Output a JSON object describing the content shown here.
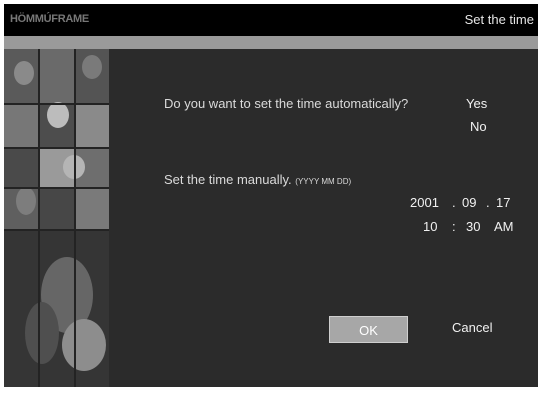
{
  "header": {
    "logo_text": "HÖMMÚFRAME",
    "title": "Set the time"
  },
  "auto_time": {
    "question": "Do you want to set the time automatically?",
    "yes_label": "Yes",
    "no_label": "No"
  },
  "manual_time": {
    "label": "Set the time manually.",
    "format_hint": "(YYYY MM DD)",
    "year": "2001",
    "month": "09",
    "day": "17",
    "hour": "10",
    "minute": "30",
    "ampm": "AM"
  },
  "buttons": {
    "ok_label": "OK",
    "cancel_label": "Cancel"
  },
  "colors": {
    "title_bar": "#000000",
    "band": "#9a9a9a",
    "panel": "#2b2b2b",
    "ok_button": "#a7a7a7"
  },
  "icons": {
    "sidebar_art": "wedding-collage"
  }
}
